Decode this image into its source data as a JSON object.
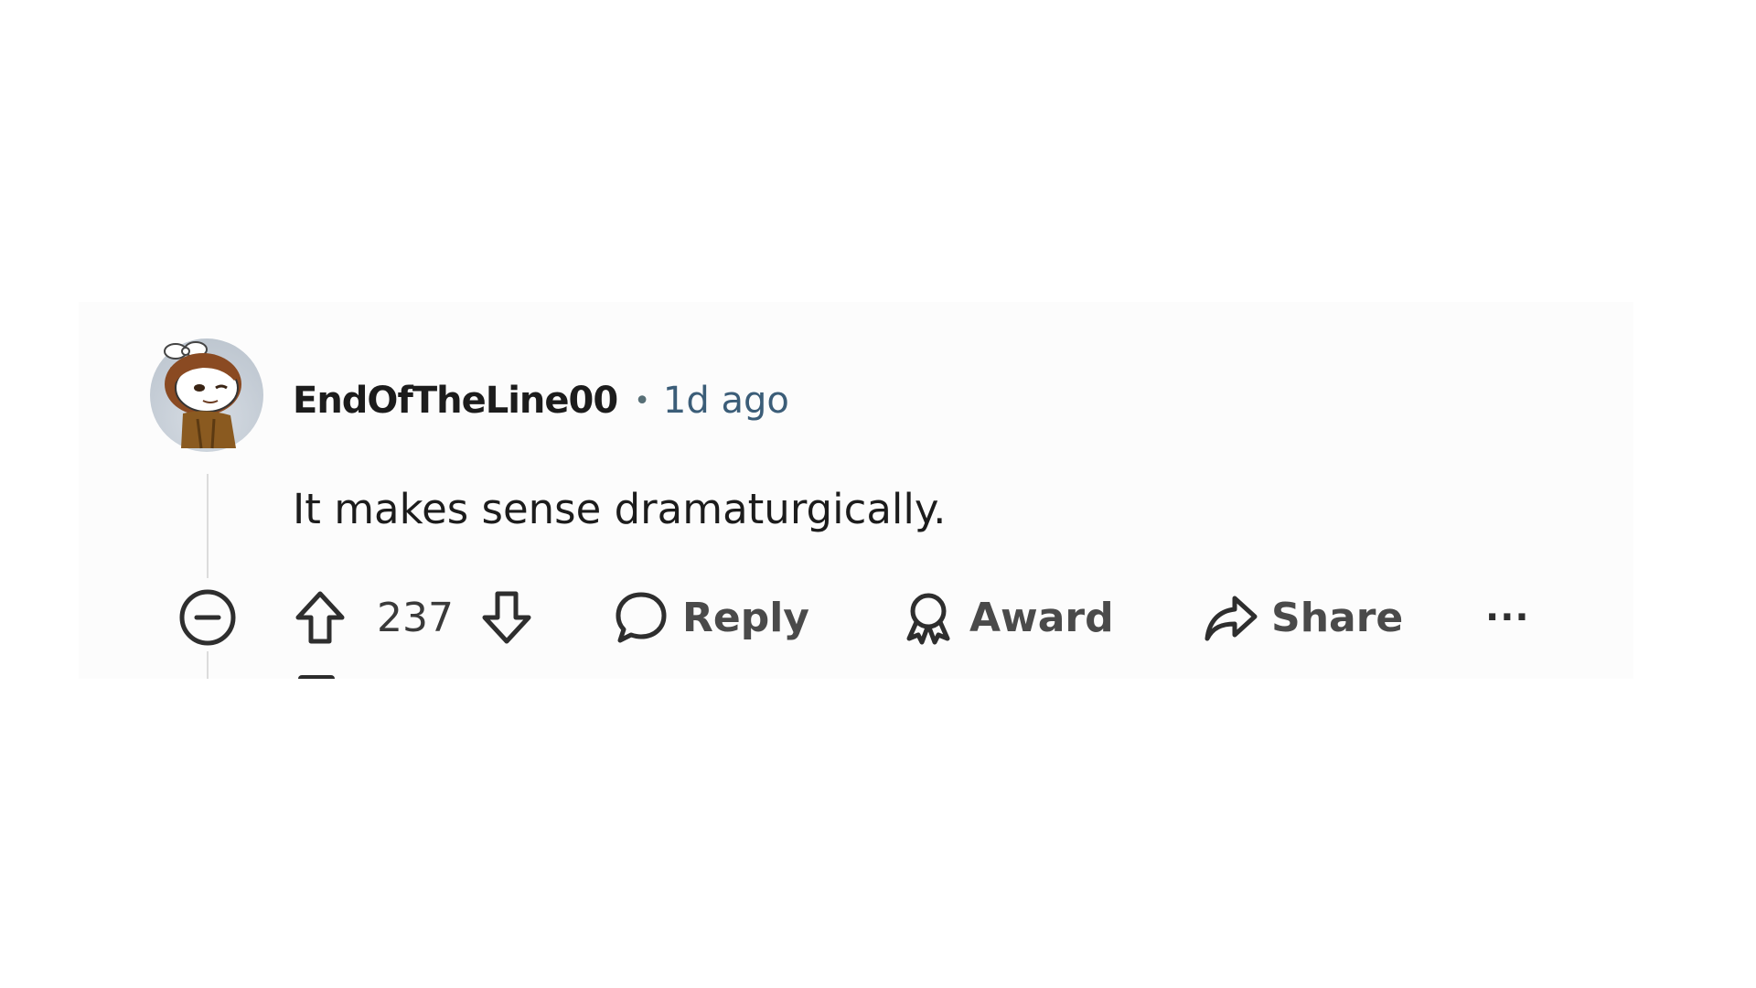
{
  "comment": {
    "username": "EndOfTheLine00",
    "separator": "•",
    "timestamp": "1d ago",
    "body": "It makes sense dramaturgically.",
    "avatar": "snoo-avatar"
  },
  "actions": {
    "collapse_icon": "collapse-circle-minus-icon",
    "upvote_icon": "upvote-arrow-icon",
    "score": "237",
    "downvote_icon": "downvote-arrow-icon",
    "reply_label": "Reply",
    "award_label": "Award",
    "share_label": "Share",
    "more_label": "···"
  }
}
